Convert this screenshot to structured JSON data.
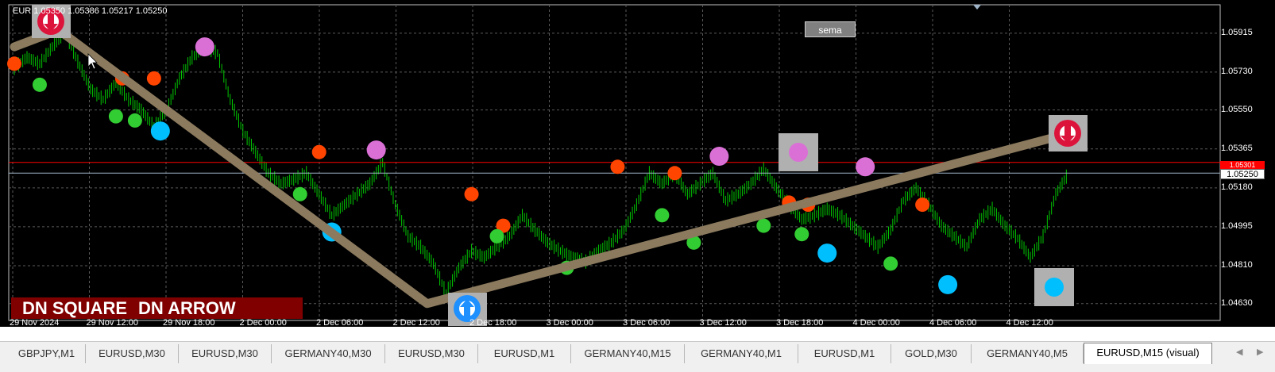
{
  "window": {
    "ohlc_header": "EUR   1.05350 1.05386 1.05217 1.05250",
    "sema_label": "sema",
    "signal_left": "DN SQUARE",
    "signal_right": "DN ARROW",
    "current_price": "1.05250",
    "red_price_tag": "1.05301"
  },
  "colors": {
    "background": "#000000",
    "grid": "#5a5a5a",
    "candles": "#00c800",
    "zigzag": "#8b7a5e",
    "red_line": "#ff0000",
    "current_price_line": "#9fb4c8",
    "dot_green": "#32cd32",
    "dot_red": "#ff4500",
    "dot_violet": "#da70d6",
    "dot_cyan": "#00bfff",
    "banner": "#800000"
  },
  "icons": {
    "top_marker": "dn-square-arrow-icon",
    "bottom_marker": "up-square-arrow-icon",
    "right_marker": "dn-square-arrow-icon"
  },
  "chart_data": {
    "type": "line",
    "symbol": "EURUSD",
    "timeframe": "M15",
    "y_ticks": [
      "1.05915",
      "1.05730",
      "1.05550",
      "1.05365",
      "1.05180",
      "1.04995",
      "1.04810",
      "1.04630"
    ],
    "ylim": [
      1.0455,
      1.0605
    ],
    "x_ticks": [
      "29 Nov 2024",
      "29 Nov 12:00",
      "29 Nov 18:00",
      "2 Dec 00:00",
      "2 Dec 06:00",
      "2 Dec 12:00",
      "2 Dec 18:00",
      "3 Dec 00:00",
      "3 Dec 06:00",
      "3 Dec 12:00",
      "3 Dec 18:00",
      "4 Dec 00:00",
      "4 Dec 06:00",
      "4 Dec 12:00"
    ],
    "price_series": [
      [
        0,
        1.0575
      ],
      [
        2,
        1.058
      ],
      [
        4,
        1.0577
      ],
      [
        6,
        1.0585
      ],
      [
        8,
        1.0592
      ],
      [
        10,
        1.0578
      ],
      [
        12,
        1.0565
      ],
      [
        14,
        1.056
      ],
      [
        16,
        1.0568
      ],
      [
        18,
        1.056
      ],
      [
        20,
        1.0555
      ],
      [
        22,
        1.0547
      ],
      [
        24,
        1.0555
      ],
      [
        26,
        1.057
      ],
      [
        28,
        1.058
      ],
      [
        30,
        1.0585
      ],
      [
        32,
        1.0582
      ],
      [
        34,
        1.056
      ],
      [
        36,
        1.0545
      ],
      [
        38,
        1.0535
      ],
      [
        40,
        1.0525
      ],
      [
        42,
        1.052
      ],
      [
        44,
        1.0522
      ],
      [
        46,
        1.0525
      ],
      [
        48,
        1.0515
      ],
      [
        50,
        1.0505
      ],
      [
        52,
        1.051
      ],
      [
        54,
        1.0515
      ],
      [
        56,
        1.052
      ],
      [
        58,
        1.053
      ],
      [
        60,
        1.051
      ],
      [
        62,
        1.0495
      ],
      [
        64,
        1.049
      ],
      [
        66,
        1.0482
      ],
      [
        68,
        1.0468
      ],
      [
        70,
        1.048
      ],
      [
        72,
        1.0488
      ],
      [
        74,
        1.0485
      ],
      [
        76,
        1.049
      ],
      [
        78,
        1.0495
      ],
      [
        80,
        1.0505
      ],
      [
        82,
        1.0498
      ],
      [
        84,
        1.0492
      ],
      [
        86,
        1.0488
      ],
      [
        88,
        1.0485
      ],
      [
        90,
        1.0483
      ],
      [
        92,
        1.0488
      ],
      [
        94,
        1.0492
      ],
      [
        96,
        1.0498
      ],
      [
        98,
        1.051
      ],
      [
        100,
        1.0525
      ],
      [
        102,
        1.052
      ],
      [
        104,
        1.0525
      ],
      [
        106,
        1.0515
      ],
      [
        108,
        1.052
      ],
      [
        110,
        1.0525
      ],
      [
        112,
        1.0512
      ],
      [
        114,
        1.0515
      ],
      [
        116,
        1.052
      ],
      [
        118,
        1.0527
      ],
      [
        120,
        1.0518
      ],
      [
        122,
        1.051
      ],
      [
        124,
        1.0503
      ],
      [
        126,
        1.0505
      ],
      [
        128,
        1.0508
      ],
      [
        130,
        1.0505
      ],
      [
        132,
        1.05
      ],
      [
        134,
        1.0495
      ],
      [
        136,
        1.049
      ],
      [
        138,
        1.0498
      ],
      [
        140,
        1.0512
      ],
      [
        142,
        1.0518
      ],
      [
        144,
        1.051
      ],
      [
        146,
        1.05
      ],
      [
        148,
        1.0495
      ],
      [
        150,
        1.049
      ],
      [
        152,
        1.0503
      ],
      [
        154,
        1.0508
      ],
      [
        156,
        1.05
      ],
      [
        158,
        1.0494
      ],
      [
        160,
        1.0485
      ],
      [
        162,
        1.0495
      ],
      [
        164,
        1.0515
      ],
      [
        166,
        1.0525
      ]
    ],
    "zigzag": [
      [
        0,
        1.0585
      ],
      [
        7,
        1.0593
      ],
      [
        65,
        1.0463
      ],
      [
        165,
        1.0543
      ]
    ],
    "dots": [
      {
        "x": 0,
        "y": 1.0577,
        "color": "red"
      },
      {
        "x": 4,
        "y": 1.0567,
        "color": "green"
      },
      {
        "x": 17,
        "y": 1.057,
        "color": "red"
      },
      {
        "x": 22,
        "y": 1.057,
        "color": "red"
      },
      {
        "x": 16,
        "y": 1.0552,
        "color": "green"
      },
      {
        "x": 19,
        "y": 1.055,
        "color": "green"
      },
      {
        "x": 23,
        "y": 1.0545,
        "color": "cyan"
      },
      {
        "x": 30,
        "y": 1.0585,
        "color": "violet"
      },
      {
        "x": 48,
        "y": 1.0535,
        "color": "red"
      },
      {
        "x": 45,
        "y": 1.0515,
        "color": "green"
      },
      {
        "x": 57,
        "y": 1.0536,
        "color": "violet"
      },
      {
        "x": 50,
        "y": 1.0497,
        "color": "cyan"
      },
      {
        "x": 72,
        "y": 1.0515,
        "color": "red"
      },
      {
        "x": 77,
        "y": 1.05,
        "color": "red"
      },
      {
        "x": 76,
        "y": 1.0495,
        "color": "green"
      },
      {
        "x": 87,
        "y": 1.048,
        "color": "green"
      },
      {
        "x": 95,
        "y": 1.0528,
        "color": "red"
      },
      {
        "x": 104,
        "y": 1.0525,
        "color": "red"
      },
      {
        "x": 102,
        "y": 1.0505,
        "color": "green"
      },
      {
        "x": 107,
        "y": 1.0492,
        "color": "green"
      },
      {
        "x": 111,
        "y": 1.0533,
        "color": "violet"
      },
      {
        "x": 118,
        "y": 1.05,
        "color": "green"
      },
      {
        "x": 122,
        "y": 1.0511,
        "color": "red"
      },
      {
        "x": 125,
        "y": 1.051,
        "color": "red"
      },
      {
        "x": 124,
        "y": 1.0496,
        "color": "green"
      },
      {
        "x": 128,
        "y": 1.0487,
        "color": "cyan"
      },
      {
        "x": 134,
        "y": 1.0528,
        "color": "violet"
      },
      {
        "x": 138,
        "y": 1.0482,
        "color": "green"
      },
      {
        "x": 143,
        "y": 1.051,
        "color": "red"
      },
      {
        "x": 147,
        "y": 1.0472,
        "color": "cyan"
      }
    ]
  },
  "tabs": [
    {
      "label": "GBPJPY,M1"
    },
    {
      "label": "EURUSD,M30"
    },
    {
      "label": "EURUSD,M30"
    },
    {
      "label": "GERMANY40,M30"
    },
    {
      "label": "EURUSD,M30"
    },
    {
      "label": "EURUSD,M1"
    },
    {
      "label": "GERMANY40,M15"
    },
    {
      "label": "GERMANY40,M1"
    },
    {
      "label": "EURUSD,M1"
    },
    {
      "label": "GOLD,M30"
    },
    {
      "label": "GERMANY40,M5"
    },
    {
      "label": "EURUSD,M15 (visual)"
    }
  ]
}
